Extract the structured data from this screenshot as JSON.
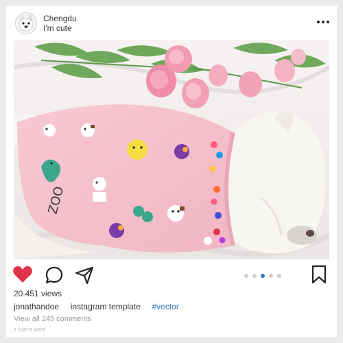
{
  "post": {
    "username": "Chengdu",
    "subtitle": "I'm cute",
    "avatar_icon": "french-bulldog-avatar",
    "menu_icon": "more-horizontal-icon"
  },
  "actions": {
    "like_icon": "heart-icon",
    "comment_icon": "comment-bubble-icon",
    "share_icon": "send-plane-icon",
    "save_icon": "bookmark-icon",
    "like_color": "#e0334b",
    "carousel_total": 5,
    "carousel_active": 3,
    "dot_active_color": "#2f78c4",
    "dot_inactive_color": "#cfcfcf"
  },
  "stats": {
    "views": "20.451 views"
  },
  "caption": {
    "author": "jonathandoe",
    "text": "instagram template",
    "hashtag": "#vector"
  },
  "comments": {
    "link": "View all 245 comments"
  },
  "timestamp": "2 DAYS AGO"
}
